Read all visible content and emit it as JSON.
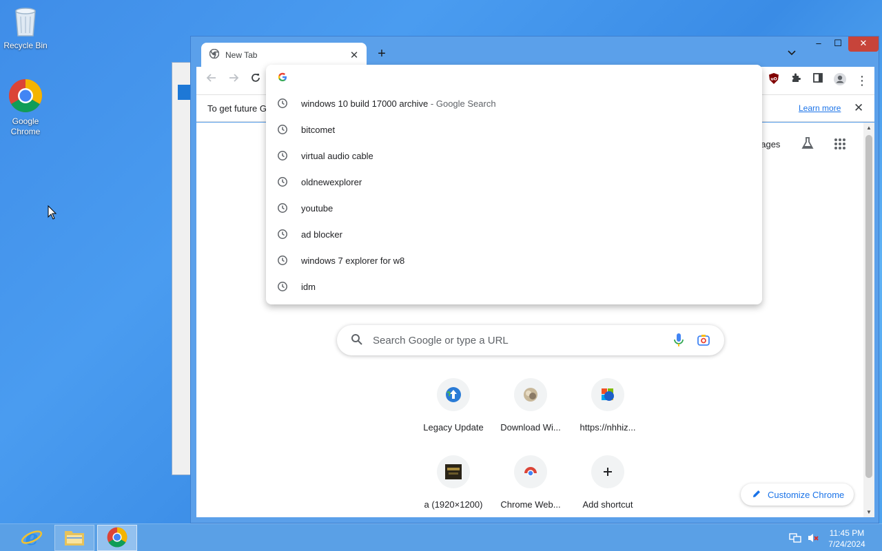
{
  "desktop": {
    "icons": [
      {
        "label": "Recycle Bin"
      },
      {
        "label": "Google Chrome"
      }
    ]
  },
  "browser": {
    "tab": {
      "title": "New Tab",
      "close_icon": "close-icon"
    },
    "window_controls": {
      "minimize": "–",
      "maximize": "☐",
      "close": "✕"
    },
    "infobar": {
      "text": "To get future G",
      "learn_more": "Learn more"
    },
    "omnibox": {
      "suggestions": [
        {
          "text": "windows 10 build 17000 archive",
          "suffix": " - Google Search"
        },
        {
          "text": "bitcomet",
          "suffix": ""
        },
        {
          "text": "virtual audio cable",
          "suffix": ""
        },
        {
          "text": "oldnewexplorer",
          "suffix": ""
        },
        {
          "text": "youtube",
          "suffix": ""
        },
        {
          "text": "ad blocker",
          "suffix": ""
        },
        {
          "text": "windows 7 explorer for w8",
          "suffix": ""
        },
        {
          "text": "idm",
          "suffix": ""
        }
      ]
    },
    "ntp": {
      "images_link": "nages",
      "search_placeholder": "Search Google or type a URL",
      "shortcuts": [
        {
          "label": "Legacy Update"
        },
        {
          "label": "Download Wi..."
        },
        {
          "label": "https://nhhiz..."
        },
        {
          "label": "a (1920×1200)"
        },
        {
          "label": "Chrome Web..."
        },
        {
          "label": "Add shortcut"
        }
      ],
      "customize": "Customize Chrome"
    }
  },
  "taskbar": {
    "time": "11:45 PM",
    "date": "7/24/2024"
  },
  "colors": {
    "accent": "#1a73e8",
    "titlebar": "#5ba0ea",
    "close_button": "#c7443a",
    "taskbar": "#5aa0e6"
  }
}
